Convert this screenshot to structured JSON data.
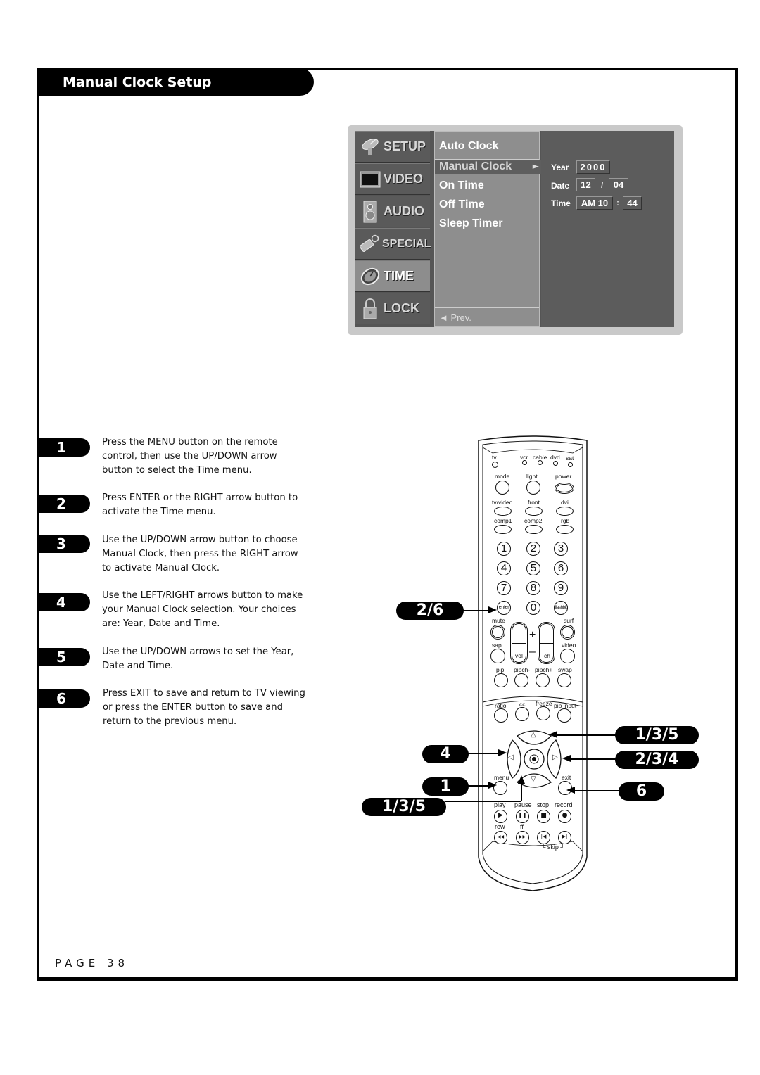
{
  "header": {
    "title": "Manual Clock Setup"
  },
  "osd_menu": {
    "categories": [
      {
        "label": "SETUP",
        "icon": "satellite-dish-icon",
        "active": false
      },
      {
        "label": "VIDEO",
        "icon": "tv-screen-icon",
        "active": false
      },
      {
        "label": "AUDIO",
        "icon": "speaker-icon",
        "active": false
      },
      {
        "label": "SPECIAL",
        "icon": "tag-icon",
        "active": false
      },
      {
        "label": "TIME",
        "icon": "clock-icon",
        "active": true
      },
      {
        "label": "LOCK",
        "icon": "padlock-icon",
        "active": false
      }
    ],
    "submenu": {
      "items": [
        "Auto Clock",
        "Manual Clock",
        "On Time",
        "Off Time",
        "Sleep Timer"
      ],
      "selected": "Manual Clock",
      "selected_arrow": "►",
      "prev_label": "◄ Prev."
    },
    "values": {
      "year_label": "Year",
      "year": "2000",
      "date_label": "Date",
      "date_month": "12",
      "date_sep": "/",
      "date_day": "04",
      "time_label": "Time",
      "time_hour": "AM 10",
      "time_sep": ":",
      "time_minute": "44"
    }
  },
  "steps": [
    {
      "number": "1",
      "text": "Press the MENU button on the remote control, then use the UP/DOWN arrow button to select the Time menu."
    },
    {
      "number": "2",
      "text": "Press ENTER or the RIGHT arrow button to activate the Time menu."
    },
    {
      "number": "3",
      "text": "Use the UP/DOWN arrow button to choose Manual Clock, then press the RIGHT arrow to activate Manual Clock."
    },
    {
      "number": "4",
      "text": "Use the LEFT/RIGHT arrows button to make your Manual Clock selection. Your choices are: Year, Date and Time."
    },
    {
      "number": "5",
      "text": "Use the UP/DOWN arrows to set the Year, Date and Time."
    },
    {
      "number": "6",
      "text": "Press EXIT to save and return to TV viewing or press the ENTER button to save and return to the previous menu."
    }
  ],
  "callouts": {
    "enter": "2/6",
    "left": "4",
    "menu": "1",
    "down": "1/3/5",
    "up": "1/3/5",
    "right": "2/3/4",
    "exit": "6"
  },
  "remote": {
    "mode_labels": [
      "tv",
      "vcr",
      "cable",
      "dvd",
      "sat"
    ],
    "row1": [
      "mode",
      "light",
      "power"
    ],
    "row2": [
      "tv/video",
      "front",
      "dvi"
    ],
    "row3": [
      "comp1",
      "comp2",
      "rgb"
    ],
    "digits": [
      "1",
      "2",
      "3",
      "4",
      "5",
      "6",
      "7",
      "8",
      "9"
    ],
    "enter_label": "enter",
    "zero": "0",
    "flashbk_label": "flashbk",
    "mute": "mute",
    "surf": "surf",
    "sap": "sap",
    "video": "video",
    "vol": "vol",
    "ch": "ch",
    "plus": "+",
    "minus": "–",
    "pip_row": [
      "pip",
      "pipch-",
      "pipch+",
      "swap"
    ],
    "lower_row": [
      "ratio",
      "cc",
      "freeze",
      "pip input"
    ],
    "menu": "menu",
    "exit": "exit",
    "transport_labels": [
      "play",
      "pause",
      "stop",
      "record"
    ],
    "transport_glyphs": [
      "▶",
      "❚❚",
      "■",
      "●"
    ],
    "seek_labels": [
      "rew",
      "ff"
    ],
    "seek_glyphs": [
      "◀◀",
      "▶▶",
      "|◀",
      "▶|"
    ],
    "skip_label": "└ skip ┘",
    "up_glyph": "△",
    "down_glyph": "▽",
    "left_glyph": "◁",
    "right_glyph": "▷"
  },
  "footer": {
    "page_label": "PAGE 38"
  }
}
